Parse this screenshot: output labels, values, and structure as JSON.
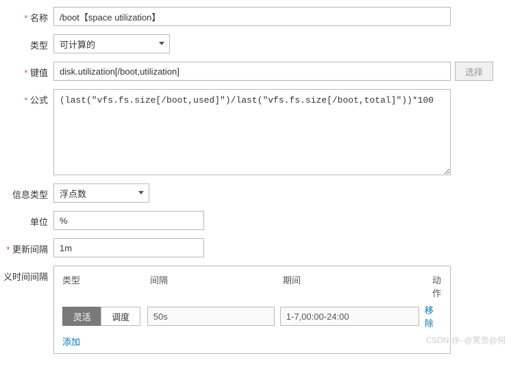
{
  "labels": {
    "name": "名称",
    "type": "类型",
    "key": "键值",
    "formula": "公式",
    "info_type": "信息类型",
    "unit": "单位",
    "update_interval": "更新间隔",
    "custom_interval": "义时间间隔"
  },
  "values": {
    "name": "/boot【space utilization】",
    "type": "可计算的",
    "key": "disk.utilization[/boot,utilization]",
    "formula": "(last(\"vfs.fs.size[/boot,used]\")/last(\"vfs.fs.size[/boot,total]\"))*100",
    "info_type": "浮点数",
    "unit": "%",
    "update_interval": "1m"
  },
  "buttons": {
    "select": "选择"
  },
  "interval_table": {
    "headers": {
      "type": "类型",
      "interval": "间隔",
      "period": "期间",
      "action": "动作"
    },
    "toggle": {
      "flexible": "灵活",
      "scheduling": "调度"
    },
    "row": {
      "interval_placeholder": "50s",
      "period_placeholder": "1-7,00:00-24:00"
    },
    "remove": "移除",
    "add": "添加"
  },
  "watermark": "CSDN @–@笑奈@何"
}
